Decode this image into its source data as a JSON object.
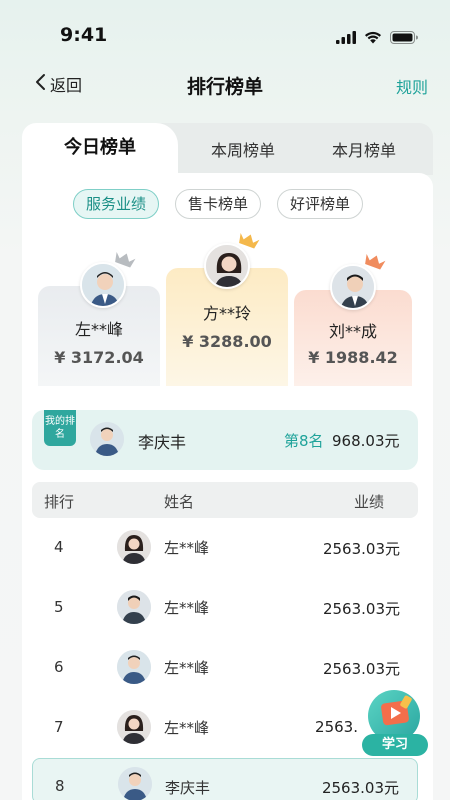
{
  "status_bar": {
    "time": "9:41"
  },
  "nav": {
    "back_label": "返回",
    "title": "排行榜单",
    "rule_label": "规则"
  },
  "tabs": [
    {
      "label": "今日榜单",
      "active": true
    },
    {
      "label": "本周榜单",
      "active": false
    },
    {
      "label": "本月榜单",
      "active": false
    }
  ],
  "filters": [
    {
      "label": "服务业绩",
      "active": true
    },
    {
      "label": "售卡榜单",
      "active": false
    },
    {
      "label": "好评榜单",
      "active": false
    }
  ],
  "podium": {
    "first": {
      "name": "方**玲",
      "score": "¥ 3288.00",
      "crown_color": "#f4b84b"
    },
    "second": {
      "name": "左**峰",
      "score": "¥ 3172.04",
      "crown_color": "#b8bcc0"
    },
    "third": {
      "name": "刘**成",
      "score": "¥ 1988.42",
      "crown_color": "#f08c5e"
    }
  },
  "my_rank": {
    "tag": "我的排名",
    "name": "李庆丰",
    "rank": "第8名",
    "score": "968.03元"
  },
  "table": {
    "headers": {
      "rank": "排行",
      "name": "姓名",
      "score": "业绩"
    },
    "rows": [
      {
        "rank": "4",
        "name": "左**峰",
        "score": "2563.03元",
        "avatar": "female"
      },
      {
        "rank": "5",
        "name": "左**峰",
        "score": "2563.03元",
        "avatar": "male"
      },
      {
        "rank": "6",
        "name": "左**峰",
        "score": "2563.03元",
        "avatar": "male"
      },
      {
        "rank": "7",
        "name": "左**峰",
        "score": "2563.",
        "avatar": "female"
      },
      {
        "rank": "8",
        "name": "李庆丰",
        "score": "2563.03元",
        "avatar": "male",
        "is_me": true
      }
    ]
  },
  "float_button": {
    "label": "学习"
  },
  "colors": {
    "accent": "#1fa39a",
    "second_bg": "#eef0f2",
    "first_bg": "#fdf2d8",
    "third_bg": "#fbe7df"
  }
}
